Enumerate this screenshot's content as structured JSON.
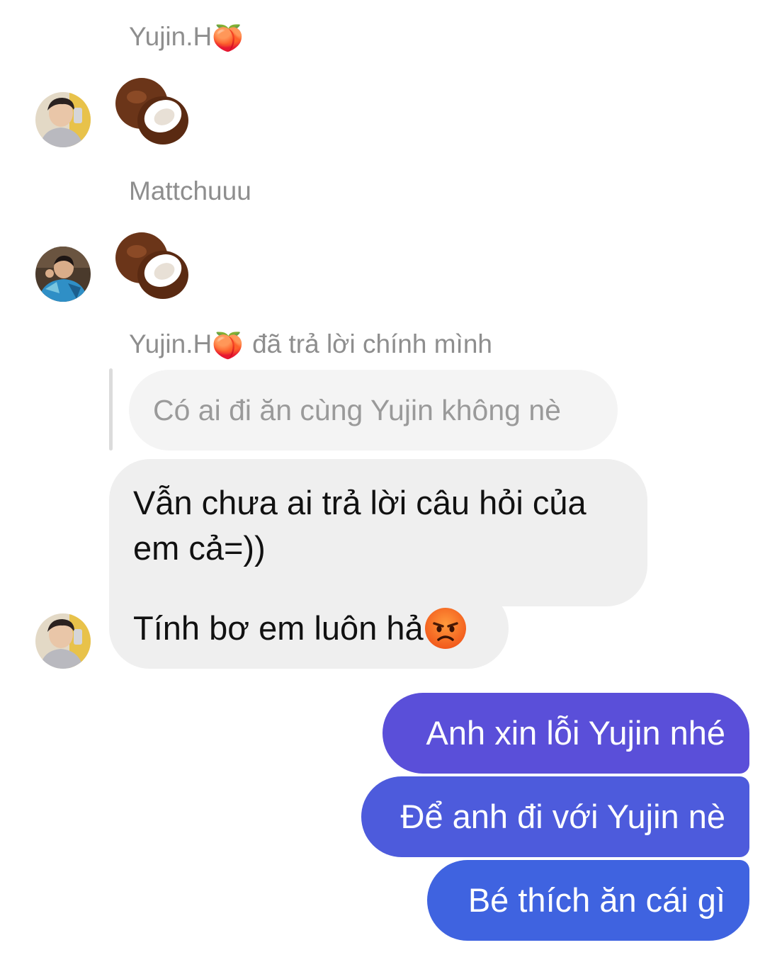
{
  "messages": [
    {
      "sender": "Yujin.H",
      "sender_emoji": "🍑",
      "content_icon": "coconut"
    },
    {
      "sender": "Mattchuuu",
      "content_icon": "coconut"
    },
    {
      "sender": "Yujin.H",
      "sender_emoji": "🍑",
      "reply_note": "đã trả lời chính mình",
      "quoted_text": "Có ai đi ăn cùng Yujin không nè",
      "bubbles": [
        "Vẫn chưa ai trả lời câu hỏi của em cả=))",
        "Tính bơ em luôn hả"
      ],
      "trailing_emoji": "angry-face"
    }
  ],
  "outgoing": [
    "Anh xin lỗi Yujin nhé",
    "Để anh đi với Yujin nè",
    "Bé thích ăn cái gì"
  ],
  "colors": {
    "outgoing_top": "#5a4fd9",
    "outgoing_mid": "#4d5bdc",
    "outgoing_bottom": "#3f63e0",
    "incoming_bubble": "#efefef",
    "sender_text": "#8e8e8e"
  }
}
